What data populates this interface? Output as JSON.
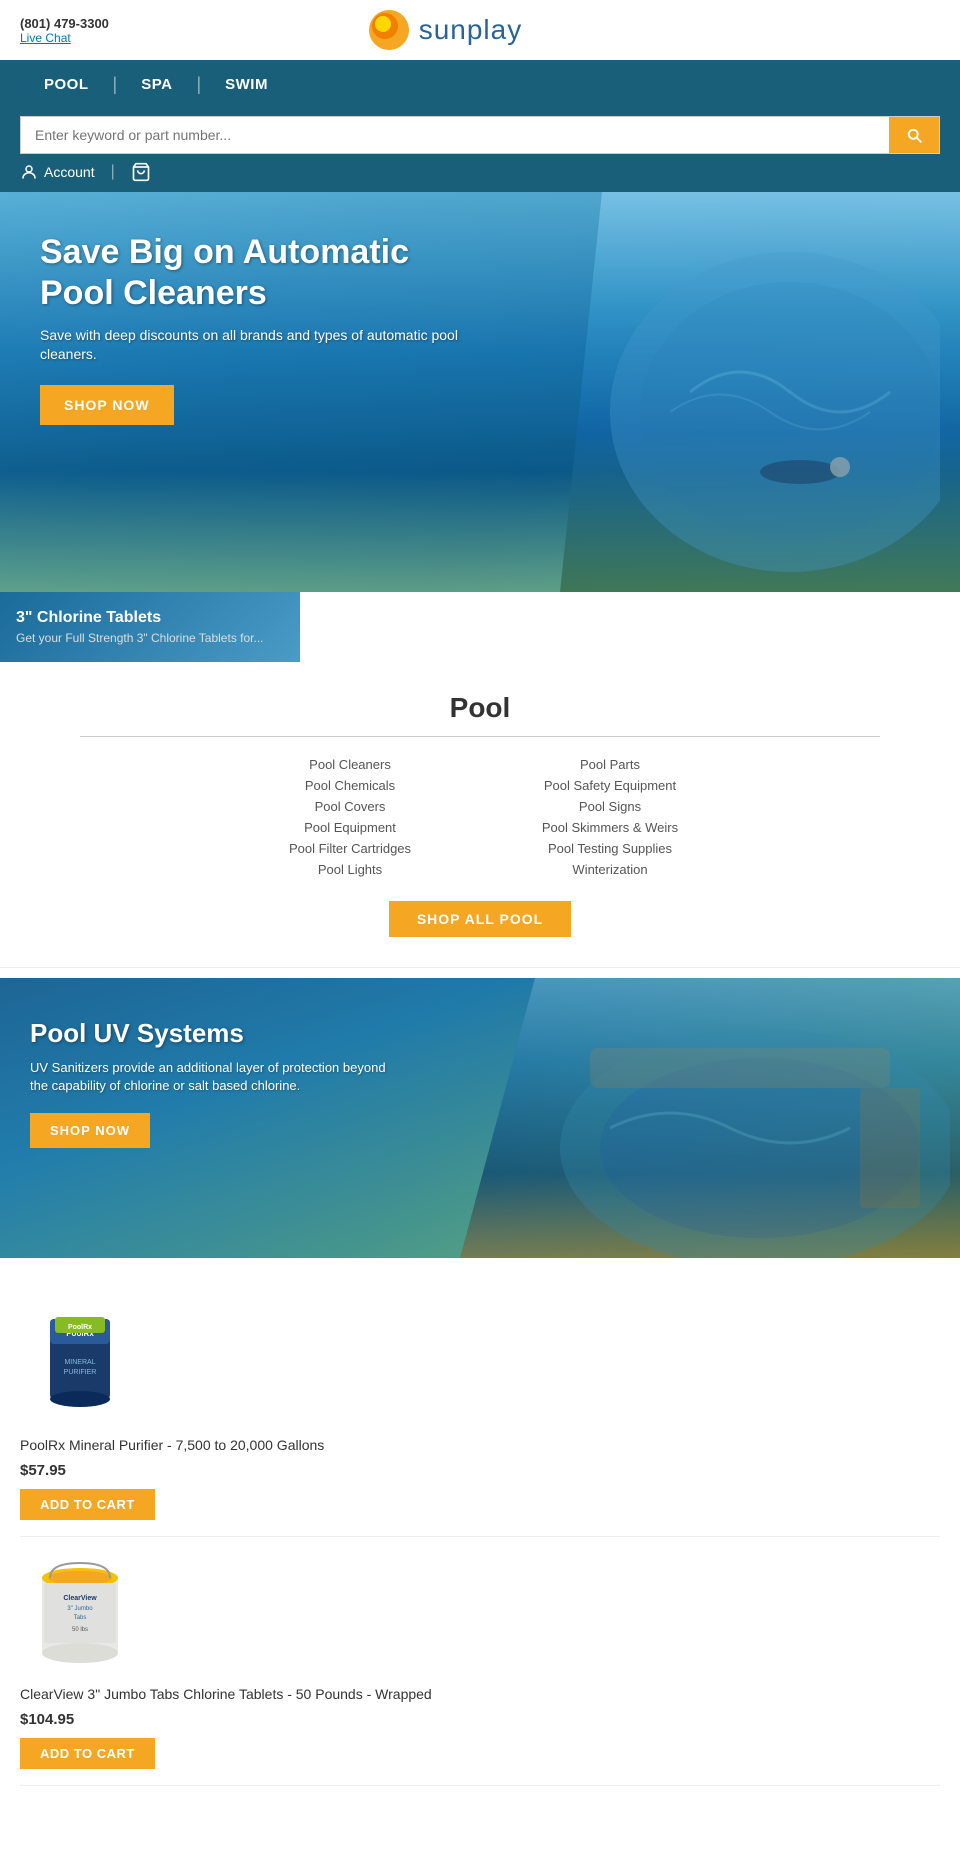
{
  "topbar": {
    "phone": "(801) 479-3300",
    "livechat": "Live Chat"
  },
  "logo": {
    "text": "sunplay"
  },
  "nav": {
    "items": [
      "POOL",
      "SPA",
      "SWIM"
    ],
    "divider": "|"
  },
  "search": {
    "placeholder": "Enter keyword or part number..."
  },
  "account": {
    "label": "Account"
  },
  "hero": {
    "title": "Save Big on Automatic Pool Cleaners",
    "subtitle": "Save with deep discounts on all brands and types of automatic pool cleaners.",
    "cta": "SHOP NOW"
  },
  "chlorine": {
    "title": "3\" Chlorine Tablets",
    "subtitle": "Get your Full Strength 3\" Chlorine Tablets for..."
  },
  "pool_section": {
    "title": "Pool",
    "links_col1": [
      "Pool Cleaners",
      "Pool Chemicals",
      "Pool Covers",
      "Pool Equipment",
      "Pool Filter Cartridges",
      "Pool Lights"
    ],
    "links_col2": [
      "Pool Parts",
      "Pool Safety Equipment",
      "Pool Signs",
      "Pool Skimmers & Weirs",
      "Pool Testing Supplies",
      "Winterization"
    ],
    "cta": "SHOP ALL POOL"
  },
  "uv_banner": {
    "title": "Pool UV Systems",
    "subtitle": "UV Sanitizers provide an additional layer of protection beyond the capability of chlorine or salt based chlorine.",
    "cta": "SHOP NOW"
  },
  "products": [
    {
      "name": "PoolRx Mineral Purifier - 7,500 to 20,000 Gallons",
      "price": "$57.95",
      "cta": "ADD TO CART",
      "type": "poolrx"
    },
    {
      "name": "ClearView 3\" Jumbo Tabs Chlorine Tablets - 50 Pounds - Wrapped",
      "price": "$104.95",
      "cta": "ADD TO CART",
      "type": "clearview"
    }
  ],
  "colors": {
    "nav_bg": "#1a5f7a",
    "orange": "#f5a623",
    "link": "#0077aa"
  }
}
